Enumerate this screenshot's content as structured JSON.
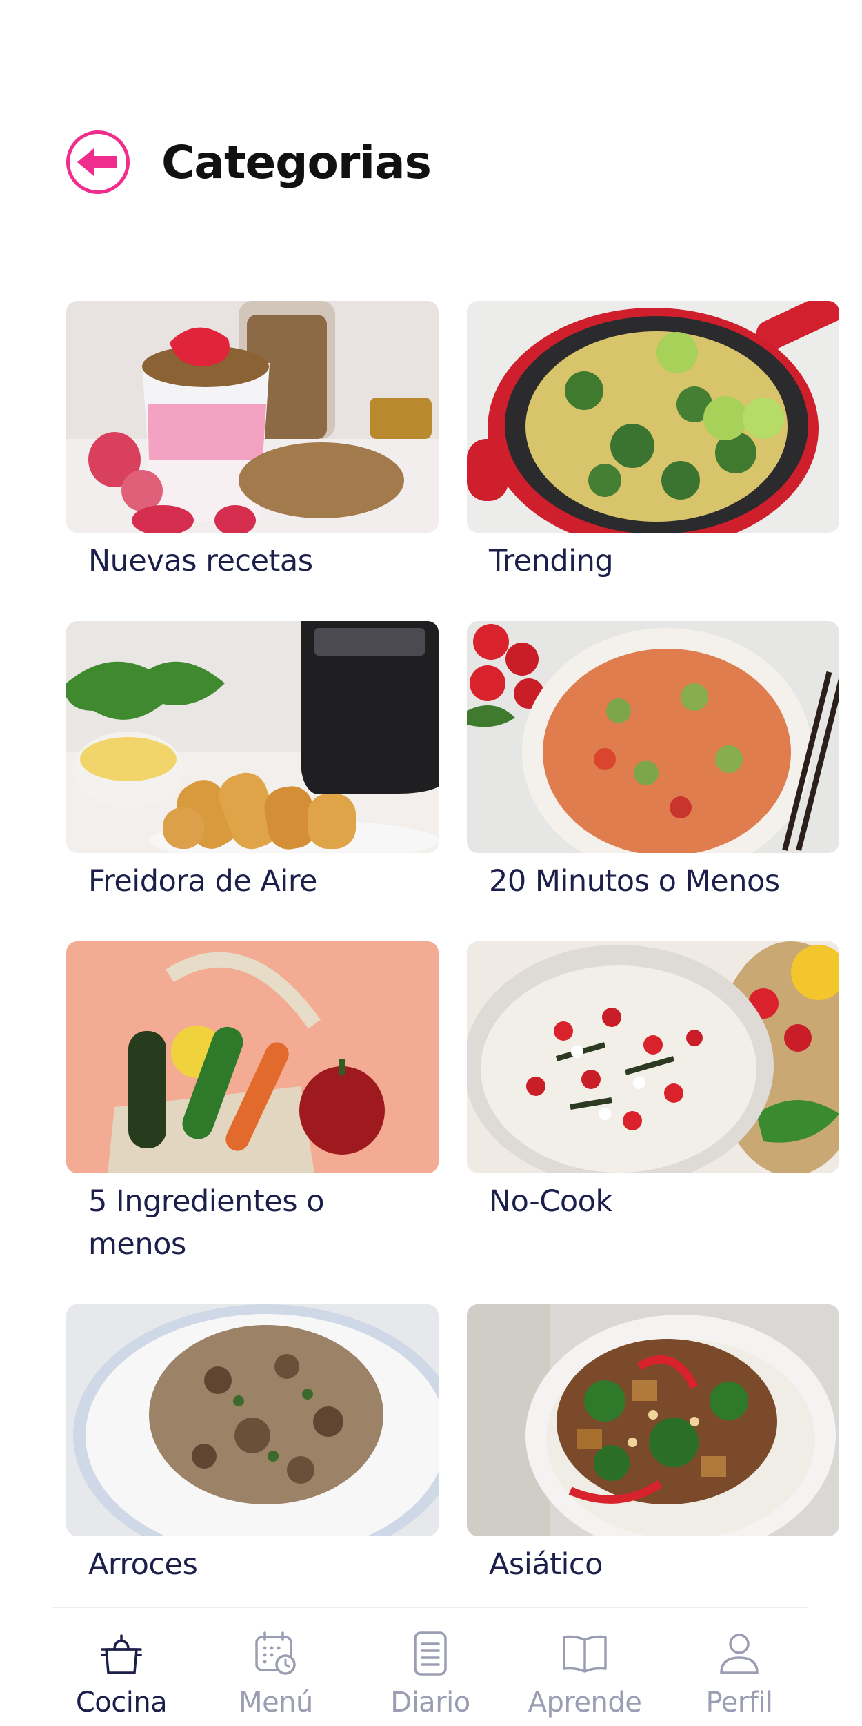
{
  "header": {
    "title": "Categorias",
    "back_icon": "arrow-left-icon",
    "accent_color": "#f02c8c"
  },
  "categories": [
    {
      "label": "Nuevas recetas",
      "image": "strawberry-yogurt-granola"
    },
    {
      "label": "Trending",
      "image": "pasta-broccoli-skillet"
    },
    {
      "label": "Freidora de Aire",
      "image": "air-fryer-croquettes"
    },
    {
      "label": "20 Minutos o Menos",
      "image": "penne-vegetables-bowl"
    },
    {
      "label": "5 Ingredientes o menos",
      "image": "vegetables-in-bag"
    },
    {
      "label": "No-Cook",
      "image": "bean-tomato-salad"
    },
    {
      "label": "Arroces",
      "image": "mushroom-rice"
    },
    {
      "label": "Asiático",
      "image": "tofu-broccoli-noodles"
    }
  ],
  "tabbar": {
    "items": [
      {
        "label": "Cocina",
        "icon": "cooking-pot-icon",
        "active": true
      },
      {
        "label": "Menú",
        "icon": "calendar-clock-icon",
        "active": false
      },
      {
        "label": "Diario",
        "icon": "notepad-icon",
        "active": false
      },
      {
        "label": "Aprende",
        "icon": "open-book-icon",
        "active": false
      },
      {
        "label": "Perfil",
        "icon": "user-icon",
        "active": false
      }
    ],
    "active_color": "#1c1f4a",
    "inactive_color": "#9b9db2"
  }
}
